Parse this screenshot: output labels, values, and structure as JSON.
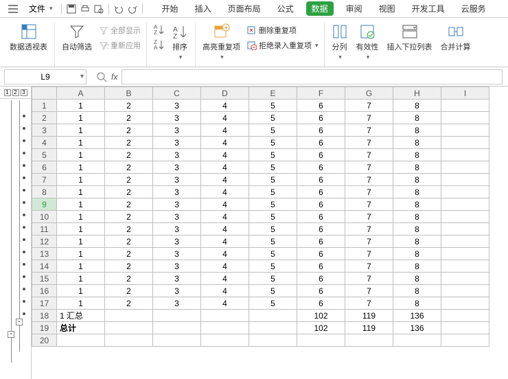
{
  "menubar": {
    "file_label": "文件",
    "tabs": [
      "开始",
      "插入",
      "页面布局",
      "公式",
      "数据",
      "审阅",
      "视图",
      "开发工具",
      "云服务"
    ],
    "active_tab_index": 4
  },
  "ribbon": {
    "pivot": "数据透视表",
    "autofilter": "自动筛选",
    "show_all": "全部显示",
    "reapply": "重新应用",
    "sort": "排序",
    "hl_dup": "高亮重复项",
    "rm_dup": "删除重复项",
    "reject_dup": "拒绝录入重复项",
    "split": "分列",
    "validity": "有效性",
    "insert_dd": "插入下拉列表",
    "consolidate": "合并计算"
  },
  "formula": {
    "cell_ref": "L9",
    "fx_value": ""
  },
  "outline_levels": [
    "1",
    "2",
    "3"
  ],
  "grid": {
    "columns": [
      "A",
      "B",
      "C",
      "D",
      "E",
      "F",
      "G",
      "H",
      "I"
    ],
    "rows": [
      {
        "r": 1,
        "c": [
          "1",
          "2",
          "3",
          "4",
          "5",
          "6",
          "7",
          "8",
          ""
        ]
      },
      {
        "r": 2,
        "c": [
          "1",
          "2",
          "3",
          "4",
          "5",
          "6",
          "7",
          "8",
          ""
        ]
      },
      {
        "r": 3,
        "c": [
          "1",
          "2",
          "3",
          "4",
          "5",
          "6",
          "7",
          "8",
          ""
        ]
      },
      {
        "r": 4,
        "c": [
          "1",
          "2",
          "3",
          "4",
          "5",
          "6",
          "7",
          "8",
          ""
        ]
      },
      {
        "r": 5,
        "c": [
          "1",
          "2",
          "3",
          "4",
          "5",
          "6",
          "7",
          "8",
          ""
        ]
      },
      {
        "r": 6,
        "c": [
          "1",
          "2",
          "3",
          "4",
          "5",
          "6",
          "7",
          "8",
          ""
        ]
      },
      {
        "r": 7,
        "c": [
          "1",
          "2",
          "3",
          "4",
          "5",
          "6",
          "7",
          "8",
          ""
        ]
      },
      {
        "r": 8,
        "c": [
          "1",
          "2",
          "3",
          "4",
          "5",
          "6",
          "7",
          "8",
          ""
        ]
      },
      {
        "r": 9,
        "c": [
          "1",
          "2",
          "3",
          "4",
          "5",
          "6",
          "7",
          "8",
          ""
        ],
        "active": true
      },
      {
        "r": 10,
        "c": [
          "1",
          "2",
          "3",
          "4",
          "5",
          "6",
          "7",
          "8",
          ""
        ]
      },
      {
        "r": 11,
        "c": [
          "1",
          "2",
          "3",
          "4",
          "5",
          "6",
          "7",
          "8",
          ""
        ]
      },
      {
        "r": 12,
        "c": [
          "1",
          "2",
          "3",
          "4",
          "5",
          "6",
          "7",
          "8",
          ""
        ]
      },
      {
        "r": 13,
        "c": [
          "1",
          "2",
          "3",
          "4",
          "5",
          "6",
          "7",
          "8",
          ""
        ]
      },
      {
        "r": 14,
        "c": [
          "1",
          "2",
          "3",
          "4",
          "5",
          "6",
          "7",
          "8",
          ""
        ]
      },
      {
        "r": 15,
        "c": [
          "1",
          "2",
          "3",
          "4",
          "5",
          "6",
          "7",
          "8",
          ""
        ]
      },
      {
        "r": 16,
        "c": [
          "1",
          "2",
          "3",
          "4",
          "5",
          "6",
          "7",
          "8",
          ""
        ]
      },
      {
        "r": 17,
        "c": [
          "1",
          "2",
          "3",
          "4",
          "5",
          "6",
          "7",
          "8",
          ""
        ]
      },
      {
        "r": 18,
        "c": [
          "1 汇总",
          "",
          "",
          "",
          "",
          "102",
          "119",
          "136",
          ""
        ],
        "sum": true
      },
      {
        "r": 19,
        "c": [
          "总计",
          "",
          "",
          "",
          "",
          "102",
          "119",
          "136",
          ""
        ],
        "grand": true
      },
      {
        "r": 20,
        "c": [
          "",
          "",
          "",
          "",
          "",
          "",
          "",
          "",
          ""
        ]
      }
    ]
  }
}
